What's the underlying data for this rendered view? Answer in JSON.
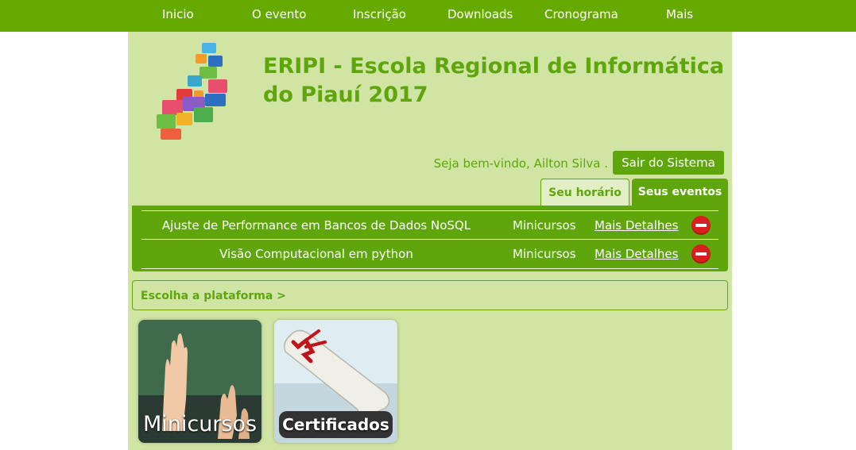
{
  "nav": {
    "items": [
      "Inicio",
      "O evento",
      "Inscrição",
      "Downloads",
      "Cronograma",
      "Mais"
    ]
  },
  "header": {
    "title": "ERIPI - Escola Regional de Informática do Piauí 2017"
  },
  "user": {
    "welcome": "Seja bem-vindo, Ailton Silva .",
    "logout_label": "Sair do Sistema"
  },
  "tabs": {
    "schedule": "Seu horário",
    "events": "Seus eventos"
  },
  "events": [
    {
      "name": "Ajuste de Performance em Bancos de Dados NoSQL",
      "type": "Minicursos",
      "link": "Mais Detalhes"
    },
    {
      "name": "Visão Computacional em python",
      "type": "Minicursos",
      "link": "Mais Detalhes"
    }
  ],
  "platform": {
    "label": "Escolha a plataforma >"
  },
  "tiles": {
    "minicursos": "Minicursos",
    "certificados": "Certificados"
  },
  "colors": {
    "brand": "#66aa00",
    "panel": "#d0e4a4",
    "accent": "#5ea60c",
    "remove": "#d81e1e"
  }
}
